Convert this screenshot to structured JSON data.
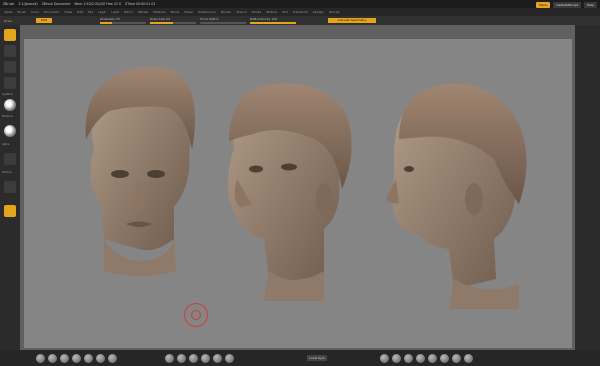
{
  "titlebar": {
    "items": [
      "ZBrush",
      "3.1(Iprocall)",
      "ZBrush Document",
      "Mem 1.5G/2.0G/4G Free 47.0",
      "ZTime 00:00:01.01"
    ],
    "right_buttons": [
      {
        "label": "Menu",
        "active": true
      },
      {
        "label": "DefaultZScript",
        "active": false
      },
      {
        "label": "Help",
        "active": false
      }
    ]
  },
  "menubar": {
    "items": [
      "Alpha",
      "Brush",
      "Color",
      "Document",
      "Draw",
      "Edit",
      "File",
      "Layer",
      "Light",
      "Macro",
      "Marker",
      "Material",
      "Movie",
      "Picker",
      "Preferences",
      "Render",
      "Stencil",
      "Stroke",
      "Texture",
      "Tool",
      "Transform",
      "Zplugin",
      "Zscript"
    ]
  },
  "toolbar": {
    "mode_label": "Draw",
    "edit_label": "Edit",
    "sliders": [
      {
        "label": "Zintensity",
        "value": 25
      },
      {
        "label": "Draw Size",
        "value": 64
      },
      {
        "label": "Focal Shift",
        "value": 0
      },
      {
        "label": "RGB Intensity",
        "value": 100
      }
    ],
    "persp_label": "Activate Symmetry"
  },
  "left_shelf": {
    "labels": [
      "Lightbox",
      "Material",
      "Alpha",
      "Texture"
    ]
  },
  "bottombar": {
    "center_label": "Local Sym"
  },
  "colors": {
    "accent": "#e6a41c",
    "canvas": "#858585",
    "cursor": "#d23a3a"
  }
}
